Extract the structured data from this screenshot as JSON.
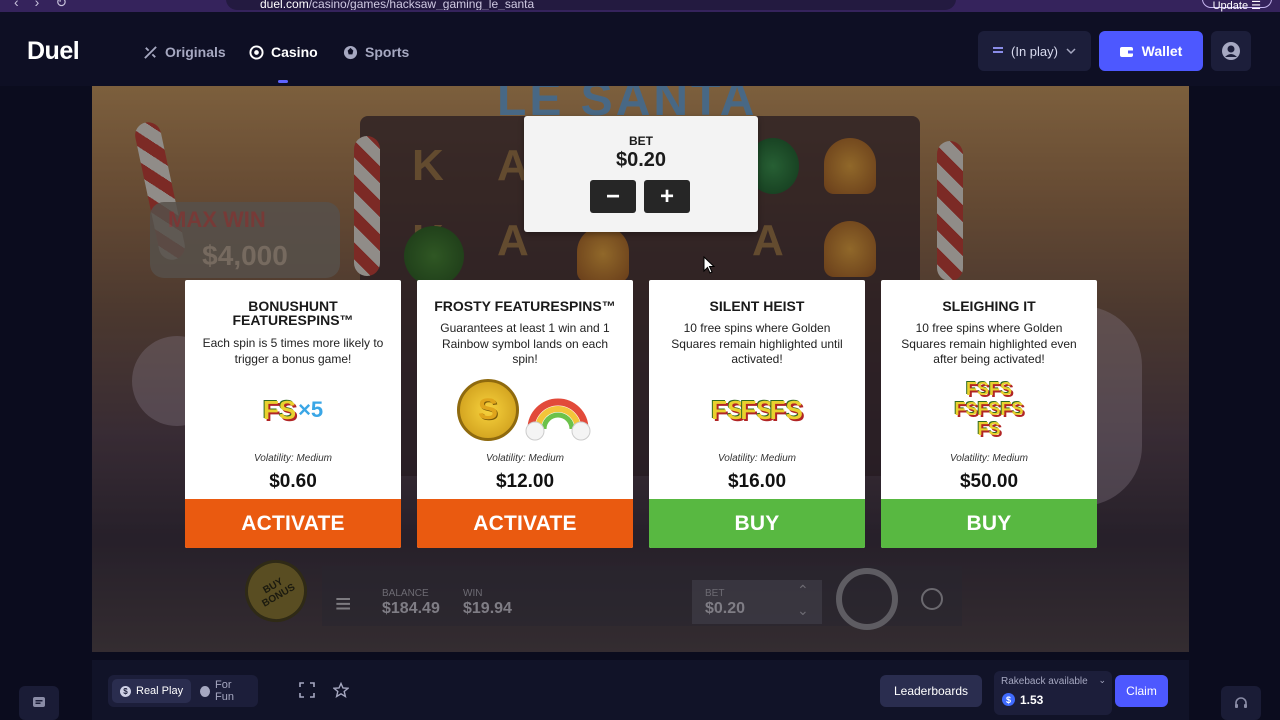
{
  "browser": {
    "url_host": "duel.com",
    "url_path": "/casino/games/hacksaw_gaming_le_santa",
    "update_label": "Update"
  },
  "header": {
    "logo": "Duel",
    "nav": [
      {
        "label": "Originals",
        "icon": "originals-icon"
      },
      {
        "label": "Casino",
        "icon": "casino-chip-icon",
        "active": true
      },
      {
        "label": "Sports",
        "icon": "sports-ball-icon"
      }
    ],
    "balance_select": "(In play)",
    "wallet_label": "Wallet"
  },
  "game": {
    "title_banner": "LE SANTA",
    "max_win_label": "MAX WIN",
    "max_win_value": "$4,000",
    "bet_popup": {
      "label": "BET",
      "value": "$0.20",
      "minus": "−",
      "plus": "+"
    },
    "hud": {
      "buy_bonus": "BUY BONUS",
      "balance_label": "BALANCE",
      "balance_value": "$184.49",
      "win_label": "WIN",
      "win_value": "$19.94",
      "bet_label": "BET",
      "bet_value": "$0.20"
    },
    "cards": [
      {
        "title": "BONUSHUNT FEATURESPINS™",
        "description": "Each spin is 5 times more likely to trigger a bonus game!",
        "volatility": "Volatility: Medium",
        "price": "$0.60",
        "button": "ACTIVATE",
        "button_color": "#ea5a10",
        "image": "fs-x5"
      },
      {
        "title": "FROSTY FEATURESPINS™",
        "description": "Guarantees at least 1 win and 1 Rainbow symbol lands on each spin!",
        "volatility": "Volatility: Medium",
        "price": "$12.00",
        "button": "ACTIVATE",
        "button_color": "#ea5a10",
        "image": "coin-rainbow"
      },
      {
        "title": "SILENT HEIST",
        "description": "10 free spins where Golden Squares remain highlighted until activated!",
        "volatility": "Volatility: Medium",
        "price": "$16.00",
        "button": "BUY",
        "button_color": "#58b841",
        "image": "fs-triple"
      },
      {
        "title": "SLEIGHING IT",
        "description": "10 free spins where Golden Squares remain highlighted even after being activated!",
        "volatility": "Volatility: Medium",
        "price": "$50.00",
        "button": "BUY",
        "button_color": "#58b841",
        "image": "fs-stack"
      }
    ]
  },
  "bottom_bar": {
    "real_play": "Real Play",
    "for_fun": "For Fun",
    "leaderboards": "Leaderboards",
    "rakeback_label": "Rakeback available",
    "rakeback_value": "1.53",
    "claim": "Claim"
  },
  "colors": {
    "accent": "#4d58ff",
    "activate": "#ea5a10",
    "buy": "#58b841",
    "background": "#0b0c1e"
  }
}
